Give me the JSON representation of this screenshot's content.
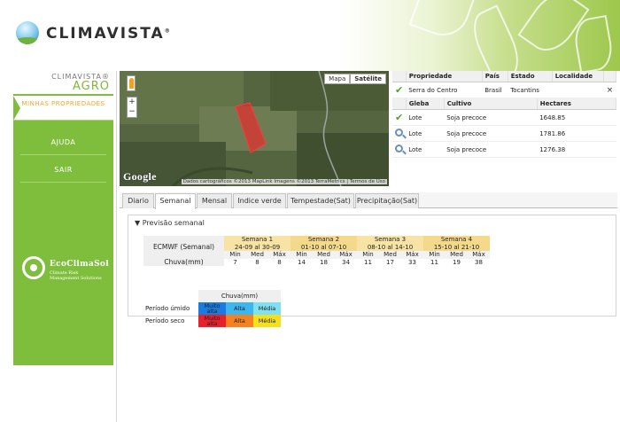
{
  "header": {
    "logo_text": "CLIMAVISTA",
    "registered": "®"
  },
  "sidebar": {
    "brand_top": "CLIMAVISTA®",
    "brand_bottom": "AGRO",
    "menu": [
      {
        "label": "MINHAS PROPRIEDADES",
        "active": true
      },
      {
        "label": "AJUDA",
        "active": false
      },
      {
        "label": "SAIR",
        "active": false
      }
    ],
    "eco_name": "EcoClimaSol",
    "eco_tag_1": "Climate Risk",
    "eco_tag_2": "Management Solutions"
  },
  "map": {
    "buttons": [
      "Mapa",
      "Satélite"
    ],
    "zoom_in": "+",
    "zoom_out": "−",
    "google": "Google",
    "attribution": "Dados cartográficos ©2013 MapLink Imagens ©2013 TerraMetrics | Termos de Uso"
  },
  "property_table": {
    "headers": [
      "Propriedade",
      "País",
      "Estado",
      "Localidade"
    ],
    "row": {
      "name": "Serra do Centro",
      "country": "Brasil",
      "state": "Tocantins",
      "locality": "",
      "close": "×"
    }
  },
  "plots_table": {
    "headers": [
      "Gleba",
      "Cultivo",
      "Hectares"
    ],
    "rows": [
      {
        "gleba": "Lote",
        "cultivo": "Soja precoce",
        "hectares": "1648.85"
      },
      {
        "gleba": "Lote",
        "cultivo": "Soja precoce",
        "hectares": "1781.86"
      },
      {
        "gleba": "Lote",
        "cultivo": "Soja precoce",
        "hectares": "1276.38"
      }
    ]
  },
  "tabs": [
    "Diario",
    "Semanal",
    "Mensal",
    "Indice verde",
    "Tempestade(Sat)",
    "Precipitação(Sat)"
  ],
  "panel": {
    "title": "Previsão semanal",
    "model_label": "ECMWF (Semanal)",
    "row_label": "Chuva(mm)",
    "sub_headers": [
      "Min",
      "Med",
      "Máx"
    ],
    "weeks": [
      {
        "name": "Semana 1",
        "range": "24-09 al 30-09",
        "values": [
          "7",
          "8",
          "8"
        ]
      },
      {
        "name": "Semana 2",
        "range": "01-10 al 07-10",
        "values": [
          "14",
          "18",
          "34"
        ]
      },
      {
        "name": "Semana 3",
        "range": "08-10 al 14-10",
        "values": [
          "11",
          "17",
          "33"
        ]
      },
      {
        "name": "Semana 4",
        "range": "15-10 al 21-10",
        "values": [
          "11",
          "19",
          "38"
        ]
      }
    ]
  },
  "legend": {
    "header": "Chuva(mm)",
    "rows": [
      {
        "label": "Período úmido",
        "cells": [
          {
            "text": "Muito alta",
            "color": "#1a7be0"
          },
          {
            "text": "Alta",
            "color": "#3db6ef"
          },
          {
            "text": "Média",
            "color": "#7fe0f2"
          }
        ]
      },
      {
        "label": "Período seco",
        "cells": [
          {
            "text": "Muito alta",
            "color": "#e8202a"
          },
          {
            "text": "Alta",
            "color": "#f5821f"
          },
          {
            "text": "Média",
            "color": "#f7e01a"
          }
        ]
      }
    ]
  }
}
